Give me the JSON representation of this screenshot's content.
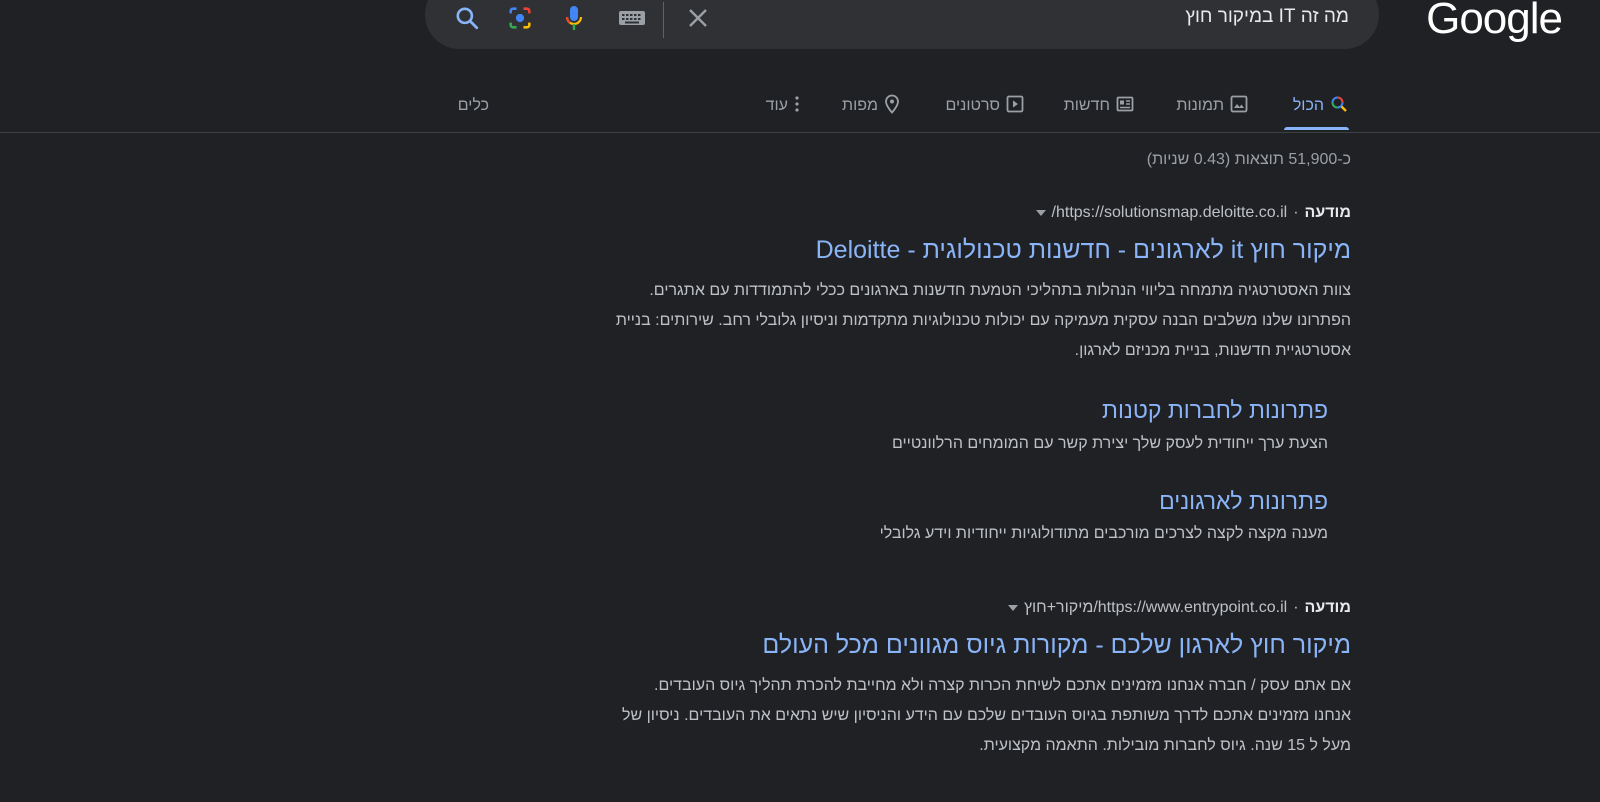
{
  "logo": {
    "text": "Google"
  },
  "search": {
    "query": "מה זה IT במיקור חוץ",
    "icons": [
      "close-icon",
      "keyboard-icon",
      "mic-icon",
      "lens-icon",
      "search-icon"
    ]
  },
  "tabs": {
    "all": "הכול",
    "images": "תמונות",
    "news": "חדשות",
    "videos": "סרטונים",
    "maps": "מפות",
    "more": "עוד",
    "tools": "כלים"
  },
  "stats": "כ-51,900 תוצאות (0.43 שניות)",
  "results": [
    {
      "ad_label": "מודעה",
      "separator": "·",
      "url": "https://solutionsmap.deloitte.co.il/",
      "title": "מיקור חוץ it לארגונים - חדשנות טכנולוגית - Deloitte",
      "snippet_lines": [
        "צוות האסטרטגיה מתמחה בליווי הנהלות בתהליכי הטמעת חדשנות בארגונים ככלי להתמודדות עם אתגרים.",
        "הפתרונו שלנו משלבים הבנה עסקית מעמיקה עם יכולות טכנולוגיות מתקדמות וניסיון גלובלי רחב. שירותים: בניית",
        "אסטרטגיית חדשנות, בניית מכניזם לארגון."
      ],
      "sitelinks": [
        {
          "title": "פתרונות לחברות קטנות",
          "snippet": "הצעת ערך ייחודית לעסק שלך יצירת קשר עם המומחים הרלוונטיים"
        },
        {
          "title": "פתרונות לארגונים",
          "snippet": "מענה מקצה לקצה לצרכים מורכבים מתודולוגיות ייחודיות וידע גלובלי"
        }
      ]
    },
    {
      "ad_label": "מודעה",
      "separator": "·",
      "url": "https://www.entrypoint.co.il/מיקור+חוץ",
      "title": "מיקור חוץ לארגון שלכם - מקורות גיוס מגוונים מכל העולם",
      "snippet_lines": [
        "אם אתם עסק / חברה אנחנו מזמינים אתכם לשיחת הכרות קצרה ולא מחייבת להכרת תהליך גיוס העובדים.",
        "אנחנו מזמינים אתכם לדרך משותפת בגיוס העובדים שלכם עם הידע והניסיון שיש נתאים את העובדים. ניסיון של",
        "מעל ל 15 שנה. גיוס לחברות מובילות. התאמה מקצועית."
      ]
    }
  ]
}
